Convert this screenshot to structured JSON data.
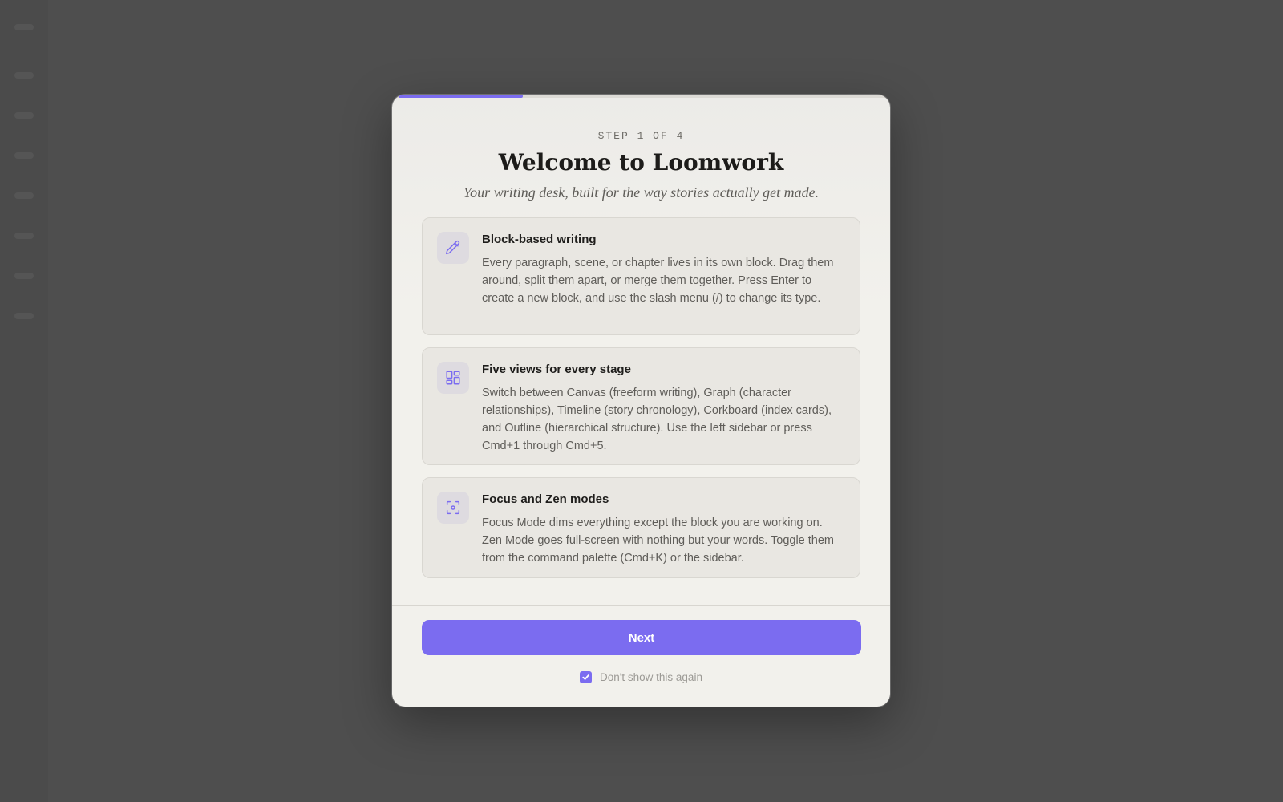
{
  "modal": {
    "progress_fraction": 0.25,
    "step_label": "STEP 1 OF 4",
    "title": "Welcome to Loomwork",
    "subtitle": "Your writing desk, built for the way stories actually get made.",
    "features": [
      {
        "icon": "pencil-icon",
        "title": "Block-based writing",
        "description": "Every paragraph, scene, or chapter lives in its own block. Drag them around, split them apart, or merge them together. Press Enter to create a new block, and use the slash menu (/) to change its type."
      },
      {
        "icon": "layout-grid-icon",
        "title": "Five views for every stage",
        "description": "Switch between Canvas (freeform writing), Graph (character relationships), Timeline (story chronology), Corkboard (index cards), and Outline (hierarchical structure). Use the left sidebar or press Cmd+1 through Cmd+5."
      },
      {
        "icon": "focus-icon",
        "title": "Focus and Zen modes",
        "description": "Focus Mode dims everything except the block you are working on. Zen Mode goes full-screen with nothing but your words. Toggle them from the command palette (Cmd+K) or the sidebar."
      }
    ],
    "next_label": "Next",
    "dont_show_label": "Don't show this again",
    "dont_show_checked": true
  },
  "colors": {
    "accent": "#7b6cf0",
    "backdrop": "#4e4e4e",
    "modal_bg": "#f2f1ec",
    "card_bg": "#e9e7e2"
  }
}
